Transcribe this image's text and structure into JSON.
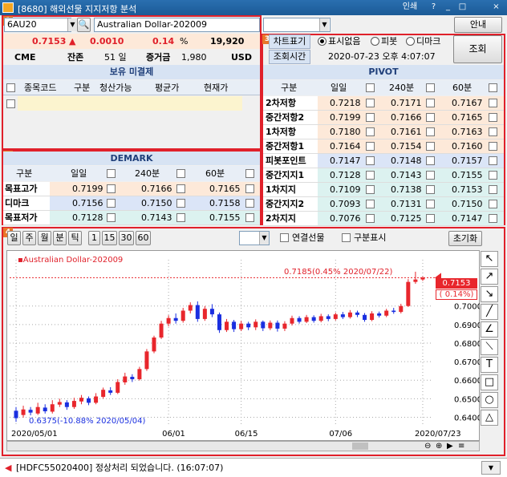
{
  "window": {
    "title": "[8680] 해외선물 지지저항 분석",
    "tools": [
      "인쇄",
      "?",
      "_",
      "□",
      "×"
    ]
  },
  "header": {
    "symbol_code": "6AU20",
    "symbol_name": "Australian Dollar-202009",
    "notice_button": "안내"
  },
  "quote": {
    "price": "0.7153",
    "arrow": "▲",
    "change": "0.0010",
    "pct": "0.14",
    "pct_unit": "%",
    "volume": "19,920",
    "exchange": "CME",
    "remain_label": "잔존",
    "remain_days": "51 일",
    "margin_label": "증거금",
    "margin": "1,980",
    "currency": "USD"
  },
  "unsettled": {
    "title": "보유 미결제",
    "columns": [
      "종목코드",
      "구분",
      "청산가능",
      "평균가",
      "현재가"
    ]
  },
  "pivot_panel": {
    "chart_mark_label": "차트표기",
    "radio_none": "표시없음",
    "radio_pivot": "피봇",
    "radio_demark": "디마크",
    "query_time_label": "조회시간",
    "query_time": "2020-07-23 오후 4:07:07",
    "query_button": "조회",
    "title": "PIVOT",
    "columns": [
      "구분",
      "일일",
      "240분",
      "60분"
    ],
    "rows": [
      {
        "label": "2차저항",
        "d": "0.7218",
        "m240": "0.7171",
        "m60": "0.7167",
        "band": "r"
      },
      {
        "label": "중간저항2",
        "d": "0.7199",
        "m240": "0.7166",
        "m60": "0.7165",
        "band": "r"
      },
      {
        "label": "1차저항",
        "d": "0.7180",
        "m240": "0.7161",
        "m60": "0.7163",
        "band": "r"
      },
      {
        "label": "중간저항1",
        "d": "0.7164",
        "m240": "0.7154",
        "m60": "0.7160",
        "band": "r"
      },
      {
        "label": "피봇포인트",
        "d": "0.7147",
        "m240": "0.7148",
        "m60": "0.7157",
        "band": "p"
      },
      {
        "label": "중간지지1",
        "d": "0.7128",
        "m240": "0.7143",
        "m60": "0.7155",
        "band": "s"
      },
      {
        "label": "1차지지",
        "d": "0.7109",
        "m240": "0.7138",
        "m60": "0.7153",
        "band": "s"
      },
      {
        "label": "중간지지2",
        "d": "0.7093",
        "m240": "0.7131",
        "m60": "0.7150",
        "band": "s"
      },
      {
        "label": "2차지지",
        "d": "0.7076",
        "m240": "0.7125",
        "m60": "0.7147",
        "band": "s"
      }
    ]
  },
  "demark": {
    "title": "DEMARK",
    "columns": [
      "구분",
      "일일",
      "240분",
      "60분"
    ],
    "rows": [
      {
        "label": "목표고가",
        "d": "0.7199",
        "m240": "0.7166",
        "m60": "0.7165",
        "band": "r"
      },
      {
        "label": "디마크",
        "d": "0.7156",
        "m240": "0.7150",
        "m60": "0.7158",
        "band": "p"
      },
      {
        "label": "목표저가",
        "d": "0.7128",
        "m240": "0.7143",
        "m60": "0.7155",
        "band": "s"
      }
    ]
  },
  "chart_toolbar": {
    "periods": [
      "일",
      "주",
      "월",
      "분",
      "틱"
    ],
    "minutes": [
      "1",
      "15",
      "30",
      "60"
    ],
    "link_label": "연결선물",
    "split_label": "구분표시",
    "reset_button": "초기화"
  },
  "chart_data": {
    "type": "candlestick",
    "legend": "Australian Dollar-202009",
    "y_ticks": [
      "0.7000",
      "0.6900",
      "0.6800",
      "0.6700",
      "0.6600",
      "0.6500",
      "0.6400"
    ],
    "x_ticks": [
      "2020/05/01",
      "06/01",
      "06/15",
      "07/06",
      "2020/07/23"
    ],
    "ylim": [
      0.635,
      0.7215
    ],
    "current": "0.7153",
    "current_change": "( 0.14%)",
    "high_note": "0.7185(0.45% 2020/07/22)",
    "low_note": "0.6375(-10.88% 2020/05/04)",
    "candles": [
      [
        0.6435,
        0.6395,
        0.6455,
        0.6375
      ],
      [
        0.6412,
        0.6442,
        0.6462,
        0.6398
      ],
      [
        0.644,
        0.6425,
        0.6455,
        0.641
      ],
      [
        0.642,
        0.6455,
        0.6478,
        0.6412
      ],
      [
        0.6452,
        0.6432,
        0.647,
        0.642
      ],
      [
        0.643,
        0.647,
        0.6492,
        0.642
      ],
      [
        0.6468,
        0.6482,
        0.65,
        0.6455
      ],
      [
        0.648,
        0.6455,
        0.6492,
        0.644
      ],
      [
        0.6455,
        0.6488,
        0.6505,
        0.6445
      ],
      [
        0.6485,
        0.6505,
        0.652,
        0.647
      ],
      [
        0.6502,
        0.6478,
        0.6512,
        0.6465
      ],
      [
        0.6478,
        0.6512,
        0.653,
        0.647
      ],
      [
        0.651,
        0.6548,
        0.656,
        0.65
      ],
      [
        0.6545,
        0.6532,
        0.6562,
        0.652
      ],
      [
        0.6532,
        0.659,
        0.6605,
        0.6525
      ],
      [
        0.6588,
        0.662,
        0.664,
        0.6575
      ],
      [
        0.6618,
        0.6605,
        0.6632,
        0.659
      ],
      [
        0.6605,
        0.666,
        0.6672,
        0.6598
      ],
      [
        0.666,
        0.6755,
        0.6768,
        0.665
      ],
      [
        0.6755,
        0.683,
        0.684,
        0.6745
      ],
      [
        0.683,
        0.6905,
        0.692,
        0.6822
      ],
      [
        0.6905,
        0.6935,
        0.695,
        0.689
      ],
      [
        0.6935,
        0.692,
        0.696,
        0.6905
      ],
      [
        0.692,
        0.6975,
        0.699,
        0.691
      ],
      [
        0.6975,
        0.7005,
        0.702,
        0.696
      ],
      [
        0.7005,
        0.693,
        0.7025,
        0.6915
      ],
      [
        0.693,
        0.6985,
        0.7,
        0.692
      ],
      [
        0.6985,
        0.6955,
        0.701,
        0.694
      ],
      [
        0.6955,
        0.687,
        0.6965,
        0.6855
      ],
      [
        0.687,
        0.6915,
        0.693,
        0.686
      ],
      [
        0.6915,
        0.6875,
        0.6925,
        0.686
      ],
      [
        0.6875,
        0.6905,
        0.692,
        0.6865
      ],
      [
        0.6905,
        0.6885,
        0.6915,
        0.687
      ],
      [
        0.6885,
        0.6915,
        0.6928,
        0.687
      ],
      [
        0.6915,
        0.688,
        0.6922,
        0.6865
      ],
      [
        0.688,
        0.691,
        0.6922,
        0.687
      ],
      [
        0.691,
        0.6878,
        0.6922,
        0.6862
      ],
      [
        0.6878,
        0.6905,
        0.6918,
        0.6865
      ],
      [
        0.6905,
        0.6935,
        0.6948,
        0.6895
      ],
      [
        0.6935,
        0.6915,
        0.6945,
        0.6905
      ],
      [
        0.6915,
        0.694,
        0.6952,
        0.6908
      ],
      [
        0.694,
        0.692,
        0.695,
        0.691
      ],
      [
        0.692,
        0.6945,
        0.6958,
        0.6912
      ],
      [
        0.6945,
        0.693,
        0.6955,
        0.6918
      ],
      [
        0.693,
        0.6955,
        0.6965,
        0.6922
      ],
      [
        0.6955,
        0.694,
        0.6968,
        0.693
      ],
      [
        0.694,
        0.6965,
        0.6978,
        0.6932
      ],
      [
        0.6965,
        0.6952,
        0.6975,
        0.694
      ],
      [
        0.6952,
        0.6925,
        0.6962,
        0.6915
      ],
      [
        0.6925,
        0.696,
        0.6972,
        0.6918
      ],
      [
        0.696,
        0.6948,
        0.697,
        0.6938
      ],
      [
        0.6948,
        0.6975,
        0.6985,
        0.694
      ],
      [
        0.6975,
        0.6968,
        0.699,
        0.6958
      ],
      [
        0.6968,
        0.7,
        0.7012,
        0.696
      ],
      [
        0.7,
        0.713,
        0.7145,
        0.6995
      ],
      [
        0.713,
        0.7143,
        0.7185,
        0.712
      ],
      [
        0.7143,
        0.7153,
        0.716,
        0.7135
      ]
    ]
  },
  "status": {
    "message": "[HDFC55020400] 정상처리 되었습니다. (16:07:07)"
  },
  "colors": {
    "up": "#e8262c",
    "down": "#1a2fe0",
    "accent": "#e0202a"
  }
}
